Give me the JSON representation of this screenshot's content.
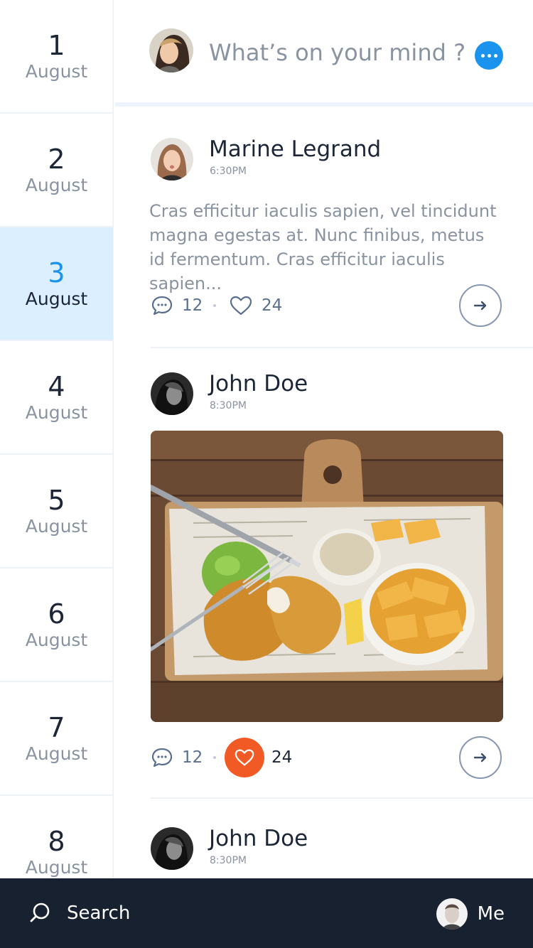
{
  "sidebar": {
    "days": [
      {
        "day": "1",
        "month": "August"
      },
      {
        "day": "2",
        "month": "August"
      },
      {
        "day": "3",
        "month": "August",
        "selected": true
      },
      {
        "day": "4",
        "month": "August"
      },
      {
        "day": "5",
        "month": "August"
      },
      {
        "day": "6",
        "month": "August"
      },
      {
        "day": "7",
        "month": "August"
      },
      {
        "day": "8",
        "month": "August"
      }
    ]
  },
  "composer": {
    "placeholder": "What’s on your mind ?"
  },
  "posts": [
    {
      "author": "Marine Legrand",
      "time": "6:30PM",
      "text": "Cras efficitur iaculis sapien, vel tincidunt magna egestas at. Nunc finibus, metus id fermentum. Cras efficitur iaculis sapien...",
      "comments": "12",
      "likes": "24",
      "liked": false
    },
    {
      "author": "John Doe",
      "time": "8:30PM",
      "comments": "12",
      "likes": "24",
      "liked": true
    },
    {
      "author": "John Doe",
      "time": "8:30PM"
    }
  ],
  "bottom_bar": {
    "search_label": "Search",
    "me_label": "Me"
  },
  "colors": {
    "accent": "#1a93ee",
    "selected_day_bg": "#dcefff",
    "like_active": "#f15a24",
    "bottom_bar": "#18212f"
  },
  "icons": {
    "comment": "speech-bubble-icon",
    "like": "heart-icon",
    "more": "ellipsis-icon",
    "open": "arrow-right-icon",
    "search": "search-icon"
  }
}
